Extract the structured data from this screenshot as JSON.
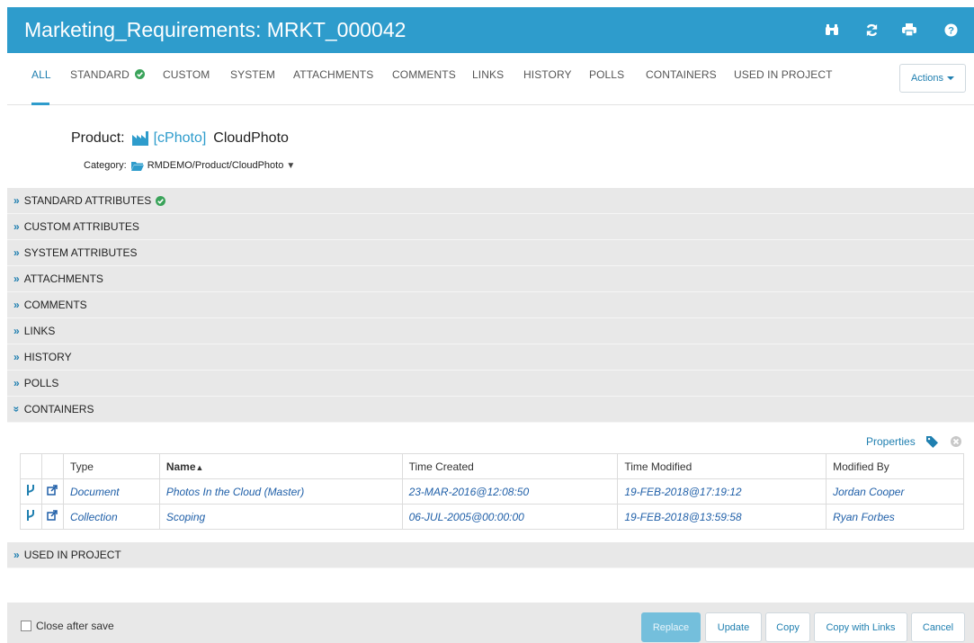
{
  "window": {
    "title": "Marketing_Requirements: MRKT_000042"
  },
  "toolbar_icons": [
    "binoculars-icon",
    "refresh-icon",
    "print-icon",
    "help-icon"
  ],
  "tabs": [
    {
      "label": "ALL",
      "active": true
    },
    {
      "label": "STANDARD",
      "badge": "check"
    },
    {
      "label": "CUSTOM"
    },
    {
      "label": "SYSTEM"
    },
    {
      "label": "ATTACHMENTS"
    },
    {
      "label": "COMMENTS"
    },
    {
      "label": "LINKS"
    },
    {
      "label": "HISTORY"
    },
    {
      "label": "POLLS"
    },
    {
      "label": "CONTAINERS"
    },
    {
      "label": "USED IN PROJECT"
    }
  ],
  "actions_label": "Actions",
  "product": {
    "label": "Product:",
    "code": "[cPhoto]",
    "name": "CloudPhoto"
  },
  "category": {
    "label": "Category:",
    "value": "RMDEMO/Product/CloudPhoto"
  },
  "sections": [
    {
      "label": "STANDARD ATTRIBUTES",
      "badge": "check",
      "expanded": false
    },
    {
      "label": "CUSTOM ATTRIBUTES",
      "expanded": false
    },
    {
      "label": "SYSTEM ATTRIBUTES",
      "expanded": false
    },
    {
      "label": "ATTACHMENTS",
      "expanded": false
    },
    {
      "label": "COMMENTS",
      "expanded": false
    },
    {
      "label": "LINKS",
      "expanded": false
    },
    {
      "label": "HISTORY",
      "expanded": false
    },
    {
      "label": "POLLS",
      "expanded": false
    },
    {
      "label": "CONTAINERS",
      "expanded": true
    }
  ],
  "properties_label": "Properties",
  "table": {
    "headers": [
      "Type",
      "Name",
      "Time Created",
      "Time Modified",
      "Modified By"
    ],
    "sorted_column": "Name",
    "rows": [
      {
        "type": "Document",
        "name": "Photos In the Cloud (Master)",
        "created": "23-MAR-2016@12:08:50",
        "modified": "19-FEB-2018@17:19:12",
        "by": "Jordan Cooper"
      },
      {
        "type": "Collection",
        "name": "Scoping",
        "created": "06-JUL-2005@00:00:00",
        "modified": "19-FEB-2018@13:59:58",
        "by": "Ryan Forbes"
      }
    ]
  },
  "used_in_project": "USED IN PROJECT",
  "footer": {
    "close_after_save": "Close after save",
    "close_after_save_checked": false,
    "buttons": {
      "replace": "Replace",
      "update": "Update",
      "copy": "Copy",
      "copy_links": "Copy with Links",
      "cancel": "Cancel"
    }
  },
  "colors": {
    "accent": "#2e9ccc",
    "link": "#1f7fb0",
    "section_bg": "#e8e8e8",
    "success": "#3aa35a"
  }
}
